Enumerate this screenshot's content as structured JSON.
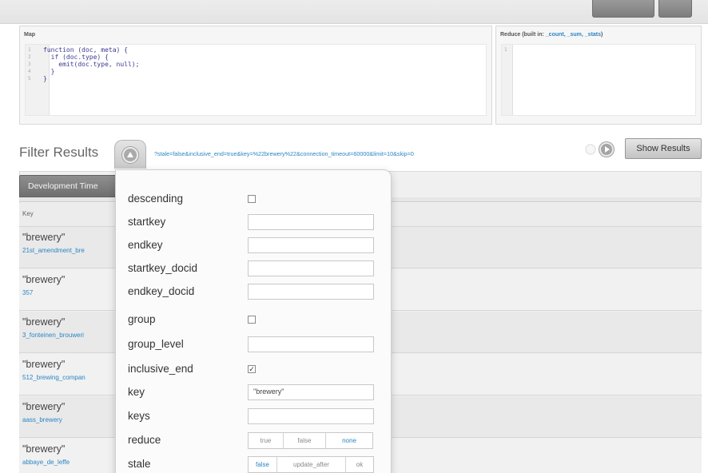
{
  "editor": {
    "map": {
      "title": "Map",
      "line_numbers": [
        "1",
        "2",
        "3",
        "4",
        "5"
      ],
      "code": [
        "function (doc, meta) {",
        "  if (doc.type) {",
        "    emit(doc.type, null);",
        "  }",
        "}"
      ]
    },
    "reduce": {
      "title_prefix": "Reduce (built in: ",
      "builtins": "_count, _sum, _stats",
      "title_suffix": ")",
      "line_numbers": [
        "1"
      ]
    }
  },
  "filter": {
    "label": "Filter Results",
    "url": "?stale=false&inclusive_end=true&key=%22brewery%22&connection_timeout=60000&limit=10&skip=0",
    "show_results_label": "Show Results"
  },
  "results": {
    "tab_label": "Development Time",
    "key_header": "Key",
    "rows": [
      {
        "key": "\"brewery\"",
        "id": "21st_amendment_bre"
      },
      {
        "key": "\"brewery\"",
        "id": "357"
      },
      {
        "key": "\"brewery\"",
        "id": "3_fonteinen_brouweri"
      },
      {
        "key": "\"brewery\"",
        "id": "512_brewing_compan"
      },
      {
        "key": "\"brewery\"",
        "id": "aass_brewery"
      },
      {
        "key": "\"brewery\"",
        "id": "abbaye_de_leffe"
      }
    ]
  },
  "params": [
    {
      "name": "descending",
      "type": "checkbox",
      "checked": false
    },
    {
      "name": "startkey",
      "type": "text",
      "value": ""
    },
    {
      "name": "endkey",
      "type": "text",
      "value": ""
    },
    {
      "name": "startkey_docid",
      "type": "text",
      "value": ""
    },
    {
      "name": "endkey_docid",
      "type": "text",
      "value": ""
    },
    {
      "name": "group",
      "type": "checkbox",
      "checked": false
    },
    {
      "name": "group_level",
      "type": "text",
      "value": ""
    },
    {
      "name": "inclusive_end",
      "type": "checkbox",
      "checked": true
    },
    {
      "name": "key",
      "type": "text",
      "value": "\"brewery\""
    },
    {
      "name": "keys",
      "type": "text",
      "value": ""
    },
    {
      "name": "reduce",
      "type": "segmented",
      "options": [
        "true",
        "false",
        "none"
      ],
      "selected": "none"
    },
    {
      "name": "stale",
      "type": "segmented",
      "options": [
        "false",
        "update_after",
        "ok"
      ],
      "selected": "false"
    }
  ],
  "colors": {
    "accent": "#2a86c4",
    "button_dark": "#7d7d7d"
  }
}
